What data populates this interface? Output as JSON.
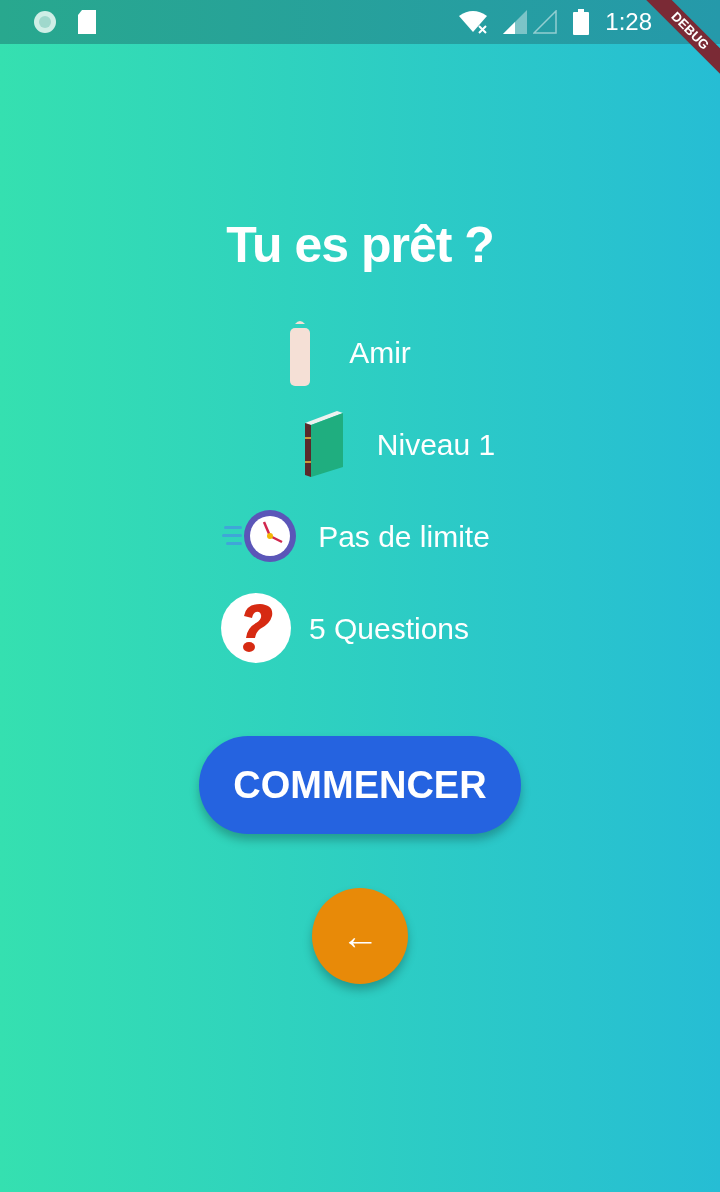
{
  "status_bar": {
    "time": "1:28",
    "debug_banner": "DEBUG"
  },
  "title": "Tu es prêt ?",
  "details": [
    {
      "kind": "person",
      "label": "Amir"
    },
    {
      "kind": "book",
      "label": "Niveau 1"
    },
    {
      "kind": "clock",
      "label": "Pas de limite"
    },
    {
      "kind": "question",
      "label": "5 Questions"
    }
  ],
  "start_button": "COMMENCER",
  "back_button": "←"
}
